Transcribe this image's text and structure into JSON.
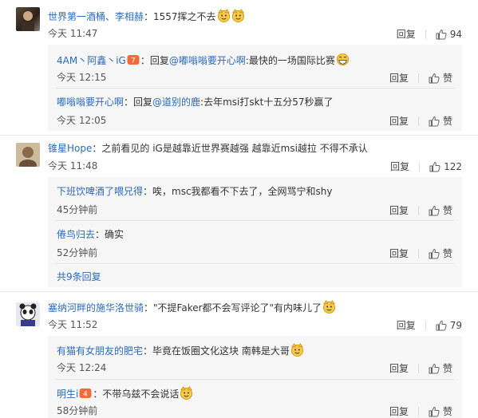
{
  "comments": [
    {
      "user": "世界第一酒桶、李相赫",
      "text": "：1557挥之不去",
      "time": "今天 11:47",
      "reply_label": "回复",
      "like_count": "94",
      "replies": [
        {
          "user": "4AM丶阿鑫丶iG",
          "text_prefix": "：回复",
          "mention": "@嘟嗡嗡要开心啊",
          "text": ":最快的一场国际比赛",
          "time": "今天 12:15",
          "reply_label": "回复",
          "like_label": "赞"
        },
        {
          "user": "嘟嗡嗡要开心啊",
          "text_prefix": "：回复",
          "mention": "@道别的鹿",
          "text": ":去年msi打skt十五分57秒赢了",
          "time": "今天 12:05",
          "reply_label": "回复",
          "like_label": "赞"
        }
      ]
    },
    {
      "user": "锥星Hope",
      "text": "：之前看见的 iG是越靠近世界赛越强 越靠近msi越拉 不得不承认",
      "time": "今天 11:48",
      "reply_label": "回复",
      "like_count": "122",
      "replies": [
        {
          "user": "下班饮啤酒了喂兄得",
          "text": "：唉，msc我都看不下去了，全网骂宁和shy",
          "time": "45分钟前",
          "reply_label": "回复",
          "like_label": "赞"
        },
        {
          "user": "倦鸟归去",
          "text": "：确实",
          "time": "52分钟前",
          "reply_label": "回复",
          "like_label": "赞"
        }
      ],
      "more_replies": "共9条回复"
    },
    {
      "user": "塞纳河畔的施华洛世骑",
      "text": "：\"不提Faker都不会写评论了\"有内味儿了",
      "time": "今天 11:52",
      "reply_label": "回复",
      "like_count": "79",
      "replies": [
        {
          "user": "有猫有女朋友的肥宅",
          "text": "：毕竟在饭圈文化这块 南韩是大哥",
          "time": "今天 12:24",
          "reply_label": "回复",
          "like_label": "赞"
        },
        {
          "user": "明生i",
          "text": "：不带乌兹不会说话",
          "time": "58分钟前",
          "reply_label": "回复",
          "like_label": "赞"
        }
      ]
    }
  ],
  "colors": {
    "link": "#2b6bb8",
    "reply_bg": "#f6f6f6",
    "divider": "#eaeaea"
  }
}
